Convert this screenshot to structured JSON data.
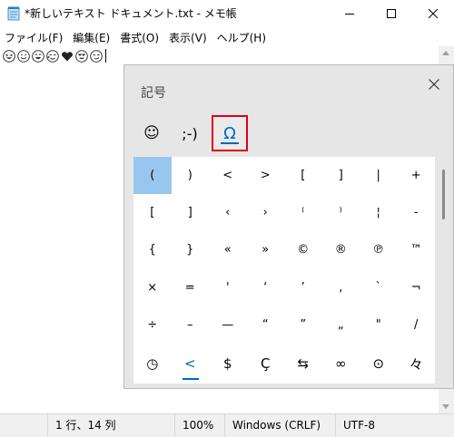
{
  "window": {
    "title": "*新しいテキスト ドキュメント.txt - メモ帳",
    "buttons": {
      "minimize": "—",
      "maximize": "☐",
      "close": "✕"
    }
  },
  "menu": [
    "ファイル(F)",
    "編集(E)",
    "書式(O)",
    "表示(V)",
    "ヘルプ(H)"
  ],
  "editor": {
    "emojis": [
      "grinning-squint-face",
      "smiling-face",
      "rolling-laughing-face",
      "face-with-tears",
      "heart",
      "heart-eyes-face",
      "smirking-face"
    ]
  },
  "status": {
    "position": "1 行、14 列",
    "zoom": "100%",
    "line_ending": "Windows (CRLF)",
    "encoding": "UTF-8"
  },
  "panel": {
    "title": "記号",
    "close": "✕",
    "tabs": [
      {
        "label": "☺",
        "icon": "smiley-icon"
      },
      {
        "label": ";-)",
        "icon": "kaomoji"
      },
      {
        "label": "Ω",
        "icon": "omega-symbol-icon"
      }
    ],
    "grid": [
      [
        "(",
        ")",
        "<",
        ">",
        "[",
        "]",
        "|",
        "+"
      ],
      [
        "[",
        "]",
        "‹",
        "›",
        "⁽",
        "⁾",
        "¦",
        "-"
      ],
      [
        "{",
        "}",
        "«",
        "»",
        "©",
        "®",
        "℗",
        "™"
      ],
      [
        "×",
        "=",
        "'",
        "‘",
        "’",
        "‚",
        "`",
        "¬"
      ],
      [
        "÷",
        "–",
        "—",
        "“",
        "”",
        "„",
        "\"",
        "/"
      ]
    ],
    "selected_cell": "(",
    "categories": [
      {
        "label": "◷",
        "name": "recent"
      },
      {
        "label": "<",
        "name": "punctuation"
      },
      {
        "label": "$",
        "name": "currency"
      },
      {
        "label": "Ç",
        "name": "latin"
      },
      {
        "label": "⇆",
        "name": "geometric"
      },
      {
        "label": "∞",
        "name": "math"
      },
      {
        "label": "⊙",
        "name": "supplemental"
      },
      {
        "label": "々",
        "name": "language"
      }
    ]
  },
  "colors": {
    "accent": "#0067c0",
    "highlight_border": "#e0001b",
    "selection": "#99c6ee",
    "panel_bg": "#e6e6e6",
    "statusbar_bg": "#f0f0f0"
  }
}
